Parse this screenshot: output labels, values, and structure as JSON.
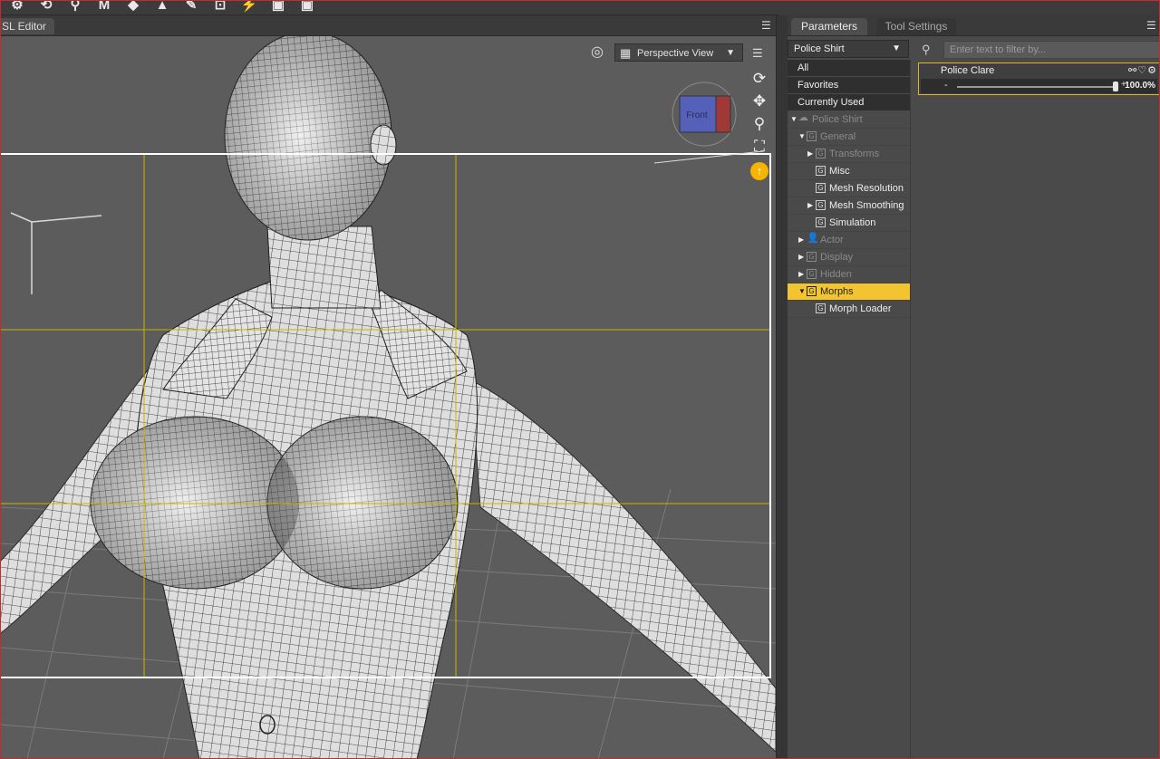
{
  "toolbar": {
    "icons": [
      "tool-icon",
      "rotate-tool-icon",
      "joint-editor-icon",
      "morph-tool-icon",
      "surface-selection-icon",
      "node-weight-icon",
      "bone-tool-icon",
      "region-tool-icon",
      "geometry-editor-icon",
      "render-icon",
      "render-settings-icon"
    ]
  },
  "left_tab": {
    "label": "SL Editor"
  },
  "viewport": {
    "view_select": "Perspective View",
    "cube_face": "Front",
    "nav_tools": [
      "orbit-icon",
      "pan-icon",
      "zoom-icon",
      "frame-icon",
      "home-icon"
    ]
  },
  "right_tabs": {
    "active": "Parameters",
    "inactive": "Tool Settings"
  },
  "node_select": {
    "value": "Police Shirt"
  },
  "categories": [
    "All",
    "Favorites",
    "Currently Used"
  ],
  "tree": [
    {
      "label": "Police Shirt",
      "level": 0,
      "expander": "▼",
      "icon": "figure",
      "style": "dim"
    },
    {
      "label": "General",
      "level": 1,
      "expander": "▼",
      "icon": "G",
      "style": "dim"
    },
    {
      "label": "Transforms",
      "level": 2,
      "expander": "▶",
      "icon": "G",
      "style": "dim"
    },
    {
      "label": "Misc",
      "level": 2,
      "expander": "",
      "icon": "G",
      "style": "bright"
    },
    {
      "label": "Mesh Resolution",
      "level": 2,
      "expander": "",
      "icon": "G",
      "style": "bright"
    },
    {
      "label": "Mesh Smoothing",
      "level": 2,
      "expander": "▶",
      "icon": "G",
      "style": "bright"
    },
    {
      "label": "Simulation",
      "level": 2,
      "expander": "",
      "icon": "G",
      "style": "bright"
    },
    {
      "label": "Actor",
      "level": 1,
      "expander": "▶",
      "icon": "person",
      "style": "dim"
    },
    {
      "label": "Display",
      "level": 1,
      "expander": "▶",
      "icon": "G",
      "style": "dim"
    },
    {
      "label": "Hidden",
      "level": 1,
      "expander": "▶",
      "icon": "G",
      "style": "dim"
    },
    {
      "label": "Morphs",
      "level": 1,
      "expander": "▼",
      "icon": "G",
      "style": "selected"
    },
    {
      "label": "Morph Loader",
      "level": 2,
      "expander": "",
      "icon": "G",
      "style": "bright"
    }
  ],
  "filter": {
    "placeholder": "Enter text to filter by..."
  },
  "property": {
    "name": "Police Clare",
    "value_text": "100.0%",
    "value": 1.0,
    "icons": [
      "link-icon",
      "favorite-icon",
      "settings-icon"
    ]
  },
  "colors": {
    "accent_selected": "#f2c42f",
    "viewport_bg": "#5c5c5c",
    "panel_bg": "#4a4a4a",
    "guide_lines": "#c8b400",
    "frame_border": "#c8282e"
  }
}
